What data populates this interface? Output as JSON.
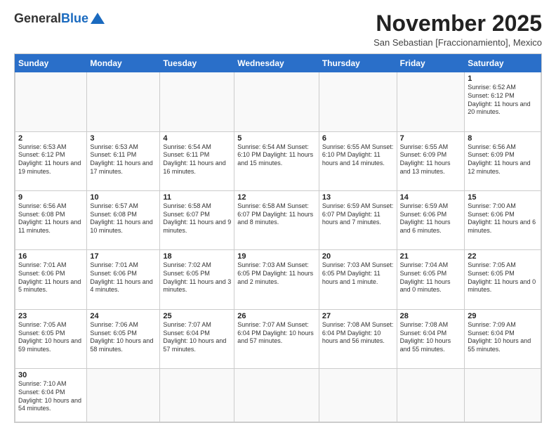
{
  "header": {
    "logo_general": "General",
    "logo_blue": "Blue",
    "month_title": "November 2025",
    "location": "San Sebastian [Fraccionamiento], Mexico"
  },
  "days_of_week": [
    "Sunday",
    "Monday",
    "Tuesday",
    "Wednesday",
    "Thursday",
    "Friday",
    "Saturday"
  ],
  "weeks": [
    [
      {
        "day": "",
        "info": ""
      },
      {
        "day": "",
        "info": ""
      },
      {
        "day": "",
        "info": ""
      },
      {
        "day": "",
        "info": ""
      },
      {
        "day": "",
        "info": ""
      },
      {
        "day": "",
        "info": ""
      },
      {
        "day": "1",
        "info": "Sunrise: 6:52 AM\nSunset: 6:12 PM\nDaylight: 11 hours and 20 minutes."
      }
    ],
    [
      {
        "day": "2",
        "info": "Sunrise: 6:53 AM\nSunset: 6:12 PM\nDaylight: 11 hours and 19 minutes."
      },
      {
        "day": "3",
        "info": "Sunrise: 6:53 AM\nSunset: 6:11 PM\nDaylight: 11 hours and 17 minutes."
      },
      {
        "day": "4",
        "info": "Sunrise: 6:54 AM\nSunset: 6:11 PM\nDaylight: 11 hours and 16 minutes."
      },
      {
        "day": "5",
        "info": "Sunrise: 6:54 AM\nSunset: 6:10 PM\nDaylight: 11 hours and 15 minutes."
      },
      {
        "day": "6",
        "info": "Sunrise: 6:55 AM\nSunset: 6:10 PM\nDaylight: 11 hours and 14 minutes."
      },
      {
        "day": "7",
        "info": "Sunrise: 6:55 AM\nSunset: 6:09 PM\nDaylight: 11 hours and 13 minutes."
      },
      {
        "day": "8",
        "info": "Sunrise: 6:56 AM\nSunset: 6:09 PM\nDaylight: 11 hours and 12 minutes."
      }
    ],
    [
      {
        "day": "9",
        "info": "Sunrise: 6:56 AM\nSunset: 6:08 PM\nDaylight: 11 hours and 11 minutes."
      },
      {
        "day": "10",
        "info": "Sunrise: 6:57 AM\nSunset: 6:08 PM\nDaylight: 11 hours and 10 minutes."
      },
      {
        "day": "11",
        "info": "Sunrise: 6:58 AM\nSunset: 6:07 PM\nDaylight: 11 hours and 9 minutes."
      },
      {
        "day": "12",
        "info": "Sunrise: 6:58 AM\nSunset: 6:07 PM\nDaylight: 11 hours and 8 minutes."
      },
      {
        "day": "13",
        "info": "Sunrise: 6:59 AM\nSunset: 6:07 PM\nDaylight: 11 hours and 7 minutes."
      },
      {
        "day": "14",
        "info": "Sunrise: 6:59 AM\nSunset: 6:06 PM\nDaylight: 11 hours and 6 minutes."
      },
      {
        "day": "15",
        "info": "Sunrise: 7:00 AM\nSunset: 6:06 PM\nDaylight: 11 hours and 6 minutes."
      }
    ],
    [
      {
        "day": "16",
        "info": "Sunrise: 7:01 AM\nSunset: 6:06 PM\nDaylight: 11 hours and 5 minutes."
      },
      {
        "day": "17",
        "info": "Sunrise: 7:01 AM\nSunset: 6:06 PM\nDaylight: 11 hours and 4 minutes."
      },
      {
        "day": "18",
        "info": "Sunrise: 7:02 AM\nSunset: 6:05 PM\nDaylight: 11 hours and 3 minutes."
      },
      {
        "day": "19",
        "info": "Sunrise: 7:03 AM\nSunset: 6:05 PM\nDaylight: 11 hours and 2 minutes."
      },
      {
        "day": "20",
        "info": "Sunrise: 7:03 AM\nSunset: 6:05 PM\nDaylight: 11 hours and 1 minute."
      },
      {
        "day": "21",
        "info": "Sunrise: 7:04 AM\nSunset: 6:05 PM\nDaylight: 11 hours and 0 minutes."
      },
      {
        "day": "22",
        "info": "Sunrise: 7:05 AM\nSunset: 6:05 PM\nDaylight: 11 hours and 0 minutes."
      }
    ],
    [
      {
        "day": "23",
        "info": "Sunrise: 7:05 AM\nSunset: 6:05 PM\nDaylight: 10 hours and 59 minutes."
      },
      {
        "day": "24",
        "info": "Sunrise: 7:06 AM\nSunset: 6:05 PM\nDaylight: 10 hours and 58 minutes."
      },
      {
        "day": "25",
        "info": "Sunrise: 7:07 AM\nSunset: 6:04 PM\nDaylight: 10 hours and 57 minutes."
      },
      {
        "day": "26",
        "info": "Sunrise: 7:07 AM\nSunset: 6:04 PM\nDaylight: 10 hours and 57 minutes."
      },
      {
        "day": "27",
        "info": "Sunrise: 7:08 AM\nSunset: 6:04 PM\nDaylight: 10 hours and 56 minutes."
      },
      {
        "day": "28",
        "info": "Sunrise: 7:08 AM\nSunset: 6:04 PM\nDaylight: 10 hours and 55 minutes."
      },
      {
        "day": "29",
        "info": "Sunrise: 7:09 AM\nSunset: 6:04 PM\nDaylight: 10 hours and 55 minutes."
      }
    ],
    [
      {
        "day": "30",
        "info": "Sunrise: 7:10 AM\nSunset: 6:04 PM\nDaylight: 10 hours and 54 minutes."
      },
      {
        "day": "",
        "info": ""
      },
      {
        "day": "",
        "info": ""
      },
      {
        "day": "",
        "info": ""
      },
      {
        "day": "",
        "info": ""
      },
      {
        "day": "",
        "info": ""
      },
      {
        "day": "",
        "info": ""
      }
    ]
  ]
}
